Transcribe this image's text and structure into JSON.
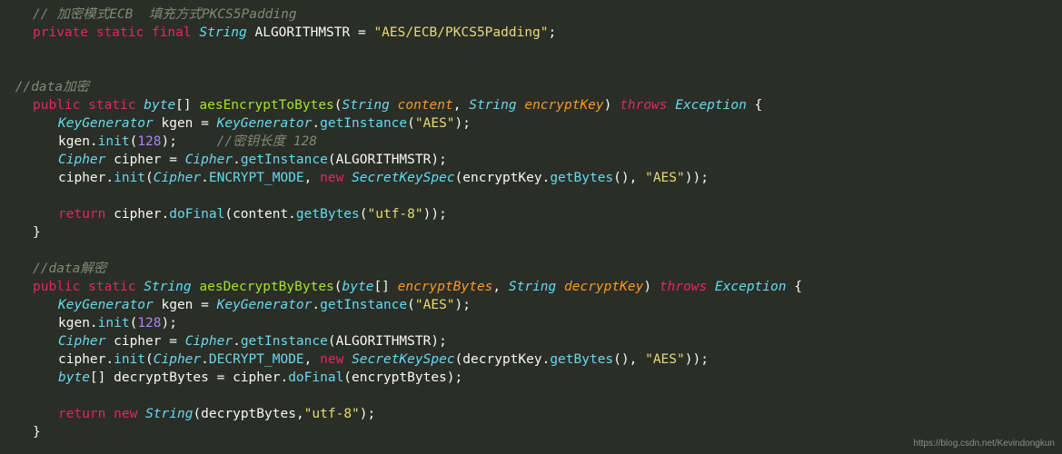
{
  "code": {
    "l1_comment": "// 加密模式ECB  填充方式PKCS5Padding",
    "l2_private": "private",
    "l2_static": "static",
    "l2_final": "final",
    "l2_type": "String",
    "l2_var": "ALGORITHMSTR",
    "l2_eq": " = ",
    "l2_str": "\"AES/ECB/PKCS5Padding\"",
    "l2_end": ";",
    "blank": "",
    "l5_comment": "//data加密",
    "l6_public": "public",
    "l6_static": "static",
    "l6_rettype": "byte",
    "l6_brackets": "[]",
    "l6_method": "aesEncryptToBytes",
    "l6_lp": "(",
    "l6_p1type": "String",
    "l6_p1name": "content",
    "l6_comma": ", ",
    "l6_p2type": "String",
    "l6_p2name": "encryptKey",
    "l6_rp": ")",
    "l6_throws": "throws",
    "l6_exc": "Exception",
    "l6_brace": " {",
    "l7_type": "KeyGenerator",
    "l7_var": " kgen = ",
    "l7_cls": "KeyGenerator",
    "l7_dot": ".",
    "l7_call": "getInstance",
    "l7_lp": "(",
    "l7_str": "\"AES\"",
    "l7_rp": ");",
    "l8_pre": "kgen.",
    "l8_call": "init",
    "l8_lp": "(",
    "l8_num": "128",
    "l8_rp": ");     ",
    "l8_comment": "//密钥长度 128",
    "l9_type": "Cipher",
    "l9_var": " cipher = ",
    "l9_cls": "Cipher",
    "l9_dot": ".",
    "l9_call": "getInstance",
    "l9_lp": "(",
    "l9_arg": "ALGORITHMSTR",
    "l9_rp": ");",
    "l10_pre": "cipher.",
    "l10_call": "init",
    "l10_lp": "(",
    "l10_cls": "Cipher",
    "l10_dot": ".",
    "l10_const": "ENCRYPT_MODE",
    "l10_c": ", ",
    "l10_new": "new",
    "l10_sp": " ",
    "l10_ctor": "SecretKeySpec",
    "l10_lp2": "(encryptKey.",
    "l10_gb": "getBytes",
    "l10_u": "(), ",
    "l10_str": "\"AES\"",
    "l10_rp": "));",
    "l12_ret": "return",
    "l12_pre": " cipher.",
    "l12_call": "doFinal",
    "l12_lp": "(content.",
    "l12_gb": "getBytes",
    "l12_lp2": "(",
    "l12_str": "\"utf-8\"",
    "l12_rp": "));",
    "l13_brace": "}",
    "l15_comment": "//data解密",
    "l16_public": "public",
    "l16_static": "static",
    "l16_rettype": "String",
    "l16_method": "aesDecryptByBytes",
    "l16_lp": "(",
    "l16_p1type": "byte",
    "l16_p1br": "[]",
    "l16_p1name": "encryptBytes",
    "l16_comma": ", ",
    "l16_p2type": "String",
    "l16_p2name": "decryptKey",
    "l16_rp": ")",
    "l16_throws": "throws",
    "l16_exc": "Exception",
    "l16_brace": " {",
    "l17_type": "KeyGenerator",
    "l17_var": " kgen = ",
    "l17_cls": "KeyGenerator",
    "l17_dot": ".",
    "l17_call": "getInstance",
    "l17_lp": "(",
    "l17_str": "\"AES\"",
    "l17_rp": ");",
    "l18_pre": "kgen.",
    "l18_call": "init",
    "l18_lp": "(",
    "l18_num": "128",
    "l18_rp": ");",
    "l19_type": "Cipher",
    "l19_var": " cipher = ",
    "l19_cls": "Cipher",
    "l19_dot": ".",
    "l19_call": "getInstance",
    "l19_lp": "(",
    "l19_arg": "ALGORITHMSTR",
    "l19_rp": ");",
    "l20_pre": "cipher.",
    "l20_call": "init",
    "l20_lp": "(",
    "l20_cls": "Cipher",
    "l20_dot": ".",
    "l20_const": "DECRYPT_MODE",
    "l20_c": ", ",
    "l20_new": "new",
    "l20_sp": " ",
    "l20_ctor": "SecretKeySpec",
    "l20_lp2": "(decryptKey.",
    "l20_gb": "getBytes",
    "l20_u": "(), ",
    "l20_str": "\"AES\"",
    "l20_rp": "));",
    "l21_type": "byte",
    "l21_br": "[]",
    "l21_var": " decryptBytes = cipher.",
    "l21_call": "doFinal",
    "l21_lp": "(encryptBytes);",
    "l23_ret": "return",
    "l23_new": "new",
    "l23_sp": " ",
    "l23_ctor": "String",
    "l23_lp": "(decryptBytes,",
    "l23_str": "\"utf-8\"",
    "l23_rp": ");",
    "l24_brace": "}"
  },
  "watermark": "https://blog.csdn.net/Kevindongkun"
}
